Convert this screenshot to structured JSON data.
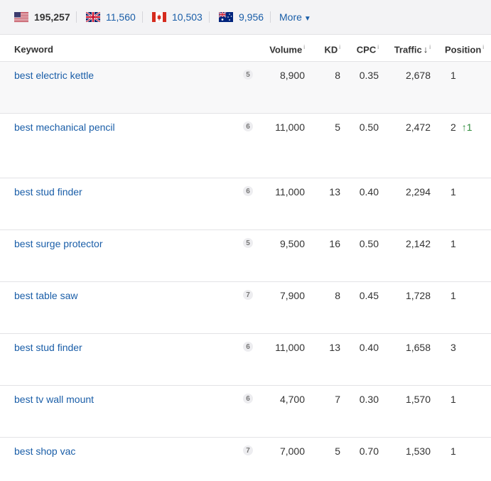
{
  "countries": [
    {
      "code": "us",
      "value": "195,257"
    },
    {
      "code": "gb",
      "value": "11,560"
    },
    {
      "code": "ca",
      "value": "10,503"
    },
    {
      "code": "au",
      "value": "9,956"
    }
  ],
  "more_label": "More",
  "columns": {
    "keyword": "Keyword",
    "volume": "Volume",
    "kd": "KD",
    "cpc": "CPC",
    "traffic": "Traffic",
    "position": "Position",
    "info": "i"
  },
  "rows": [
    {
      "keyword": "best electric kettle",
      "badge": "5",
      "volume": "8,900",
      "kd": "8",
      "cpc": "0.35",
      "traffic": "2,678",
      "position": "1",
      "change": ""
    },
    {
      "keyword": "best mechanical pencil",
      "badge": "6",
      "volume": "11,000",
      "kd": "5",
      "cpc": "0.50",
      "traffic": "2,472",
      "position": "2",
      "change": "↑1"
    },
    {
      "keyword": "best stud finder",
      "badge": "6",
      "volume": "11,000",
      "kd": "13",
      "cpc": "0.40",
      "traffic": "2,294",
      "position": "1",
      "change": ""
    },
    {
      "keyword": "best surge protector",
      "badge": "5",
      "volume": "9,500",
      "kd": "16",
      "cpc": "0.50",
      "traffic": "2,142",
      "position": "1",
      "change": ""
    },
    {
      "keyword": "best table saw",
      "badge": "7",
      "volume": "7,900",
      "kd": "8",
      "cpc": "0.45",
      "traffic": "1,728",
      "position": "1",
      "change": ""
    },
    {
      "keyword": "best stud finder",
      "badge": "6",
      "volume": "11,000",
      "kd": "13",
      "cpc": "0.40",
      "traffic": "1,658",
      "position": "3",
      "change": ""
    },
    {
      "keyword": "best tv wall mount",
      "badge": "6",
      "volume": "4,700",
      "kd": "7",
      "cpc": "0.30",
      "traffic": "1,570",
      "position": "1",
      "change": ""
    },
    {
      "keyword": "best shop vac",
      "badge": "7",
      "volume": "7,000",
      "kd": "5",
      "cpc": "0.70",
      "traffic": "1,530",
      "position": "1",
      "change": ""
    }
  ]
}
